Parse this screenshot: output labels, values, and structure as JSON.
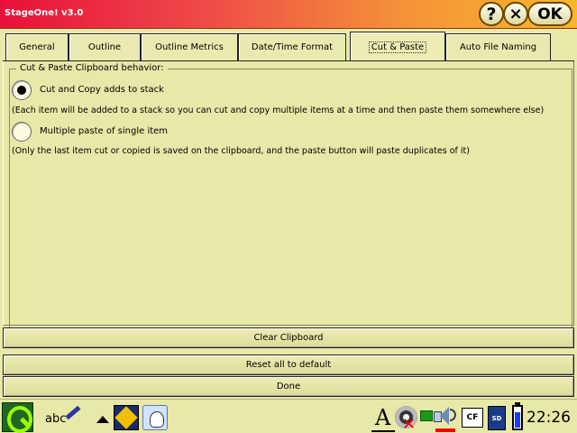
{
  "window": {
    "title": "StageOne! v3.0",
    "help_label": "?",
    "close_label": "×",
    "ok_label": "OK"
  },
  "tabs": [
    {
      "label": "General",
      "active": false
    },
    {
      "label": "Outline",
      "active": false
    },
    {
      "label": "Outline Metrics",
      "active": false
    },
    {
      "label": "Date/Time Format",
      "active": false
    },
    {
      "label": "Cut & Paste",
      "active": true
    },
    {
      "label": "Auto File Naming",
      "active": false
    }
  ],
  "group": {
    "title": "Cut & Paste Clipboard behavior:",
    "options": [
      {
        "label": "Cut and Copy adds to stack",
        "checked": true,
        "description": "(Each item will be added to a stack so you can cut and copy multiple items at a time and then paste them somewhere else)"
      },
      {
        "label": "Multiple paste of single item",
        "checked": false,
        "description": "(Only the last item cut or copied is saved on the clipboard, and the paste button will paste duplicates of it)"
      }
    ]
  },
  "buttons": {
    "clear_clipboard": "Clear Clipboard",
    "reset_all": "Reset all to default",
    "done": "Done"
  },
  "taskbar": {
    "input_method_text": "abc",
    "font_indicator": "A",
    "cf_label": "CF",
    "sd_label": "SD",
    "battery_level": 0.75,
    "clock": "22:26",
    "icons": [
      "qtopia-launcher-icon",
      "handwriting-input-icon",
      "menu-up-arrow-icon",
      "app-icon",
      "app-icon",
      "font-icon",
      "cd-icon",
      "network-icon",
      "speaker-icon",
      "compact-flash-icon",
      "sd-card-icon",
      "battery-icon"
    ]
  },
  "colors": {
    "background": "#e8e8a8",
    "titlebar_start": "#e8103a",
    "titlebar_end": "#f8b62c"
  }
}
